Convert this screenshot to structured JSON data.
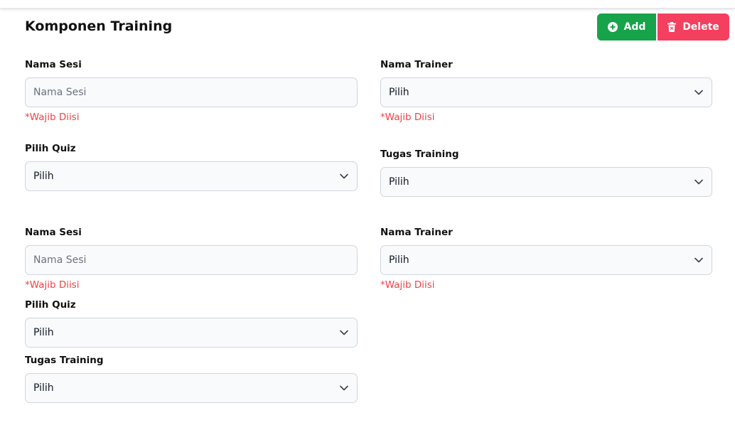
{
  "header": {
    "title": "Komponen Training",
    "add_label": "Add",
    "delete_label": "Delete"
  },
  "colors": {
    "add_button": "#17a34a",
    "delete_button": "#f43f5e",
    "required_text": "#ef4444"
  },
  "icons": {
    "add": "plus-circle-icon",
    "delete": "trash-icon",
    "select": "chevron-down-icon"
  },
  "sessions": [
    {
      "nama_sesi_label": "Nama Sesi",
      "nama_sesi_placeholder": "Nama Sesi",
      "nama_sesi_required": "*Wajib Diisi",
      "nama_trainer_label": "Nama Trainer",
      "nama_trainer_value": "Pilih",
      "nama_trainer_required": "*Wajib Diisi",
      "pilih_quiz_label": "Pilih Quiz",
      "pilih_quiz_value": "Pilih",
      "tugas_training_label": "Tugas Training",
      "tugas_training_value": "Pilih"
    },
    {
      "nama_sesi_label": "Nama Sesi",
      "nama_sesi_placeholder": "Nama Sesi",
      "nama_sesi_required": "*Wajib Diisi",
      "nama_trainer_label": "Nama Trainer",
      "nama_trainer_value": "Pilih",
      "nama_trainer_required": "*Wajib Diisi",
      "pilih_quiz_label": "Pilih Quiz",
      "pilih_quiz_value": "Pilih",
      "tugas_training_label": "Tugas Training",
      "tugas_training_value": "Pilih"
    }
  ]
}
